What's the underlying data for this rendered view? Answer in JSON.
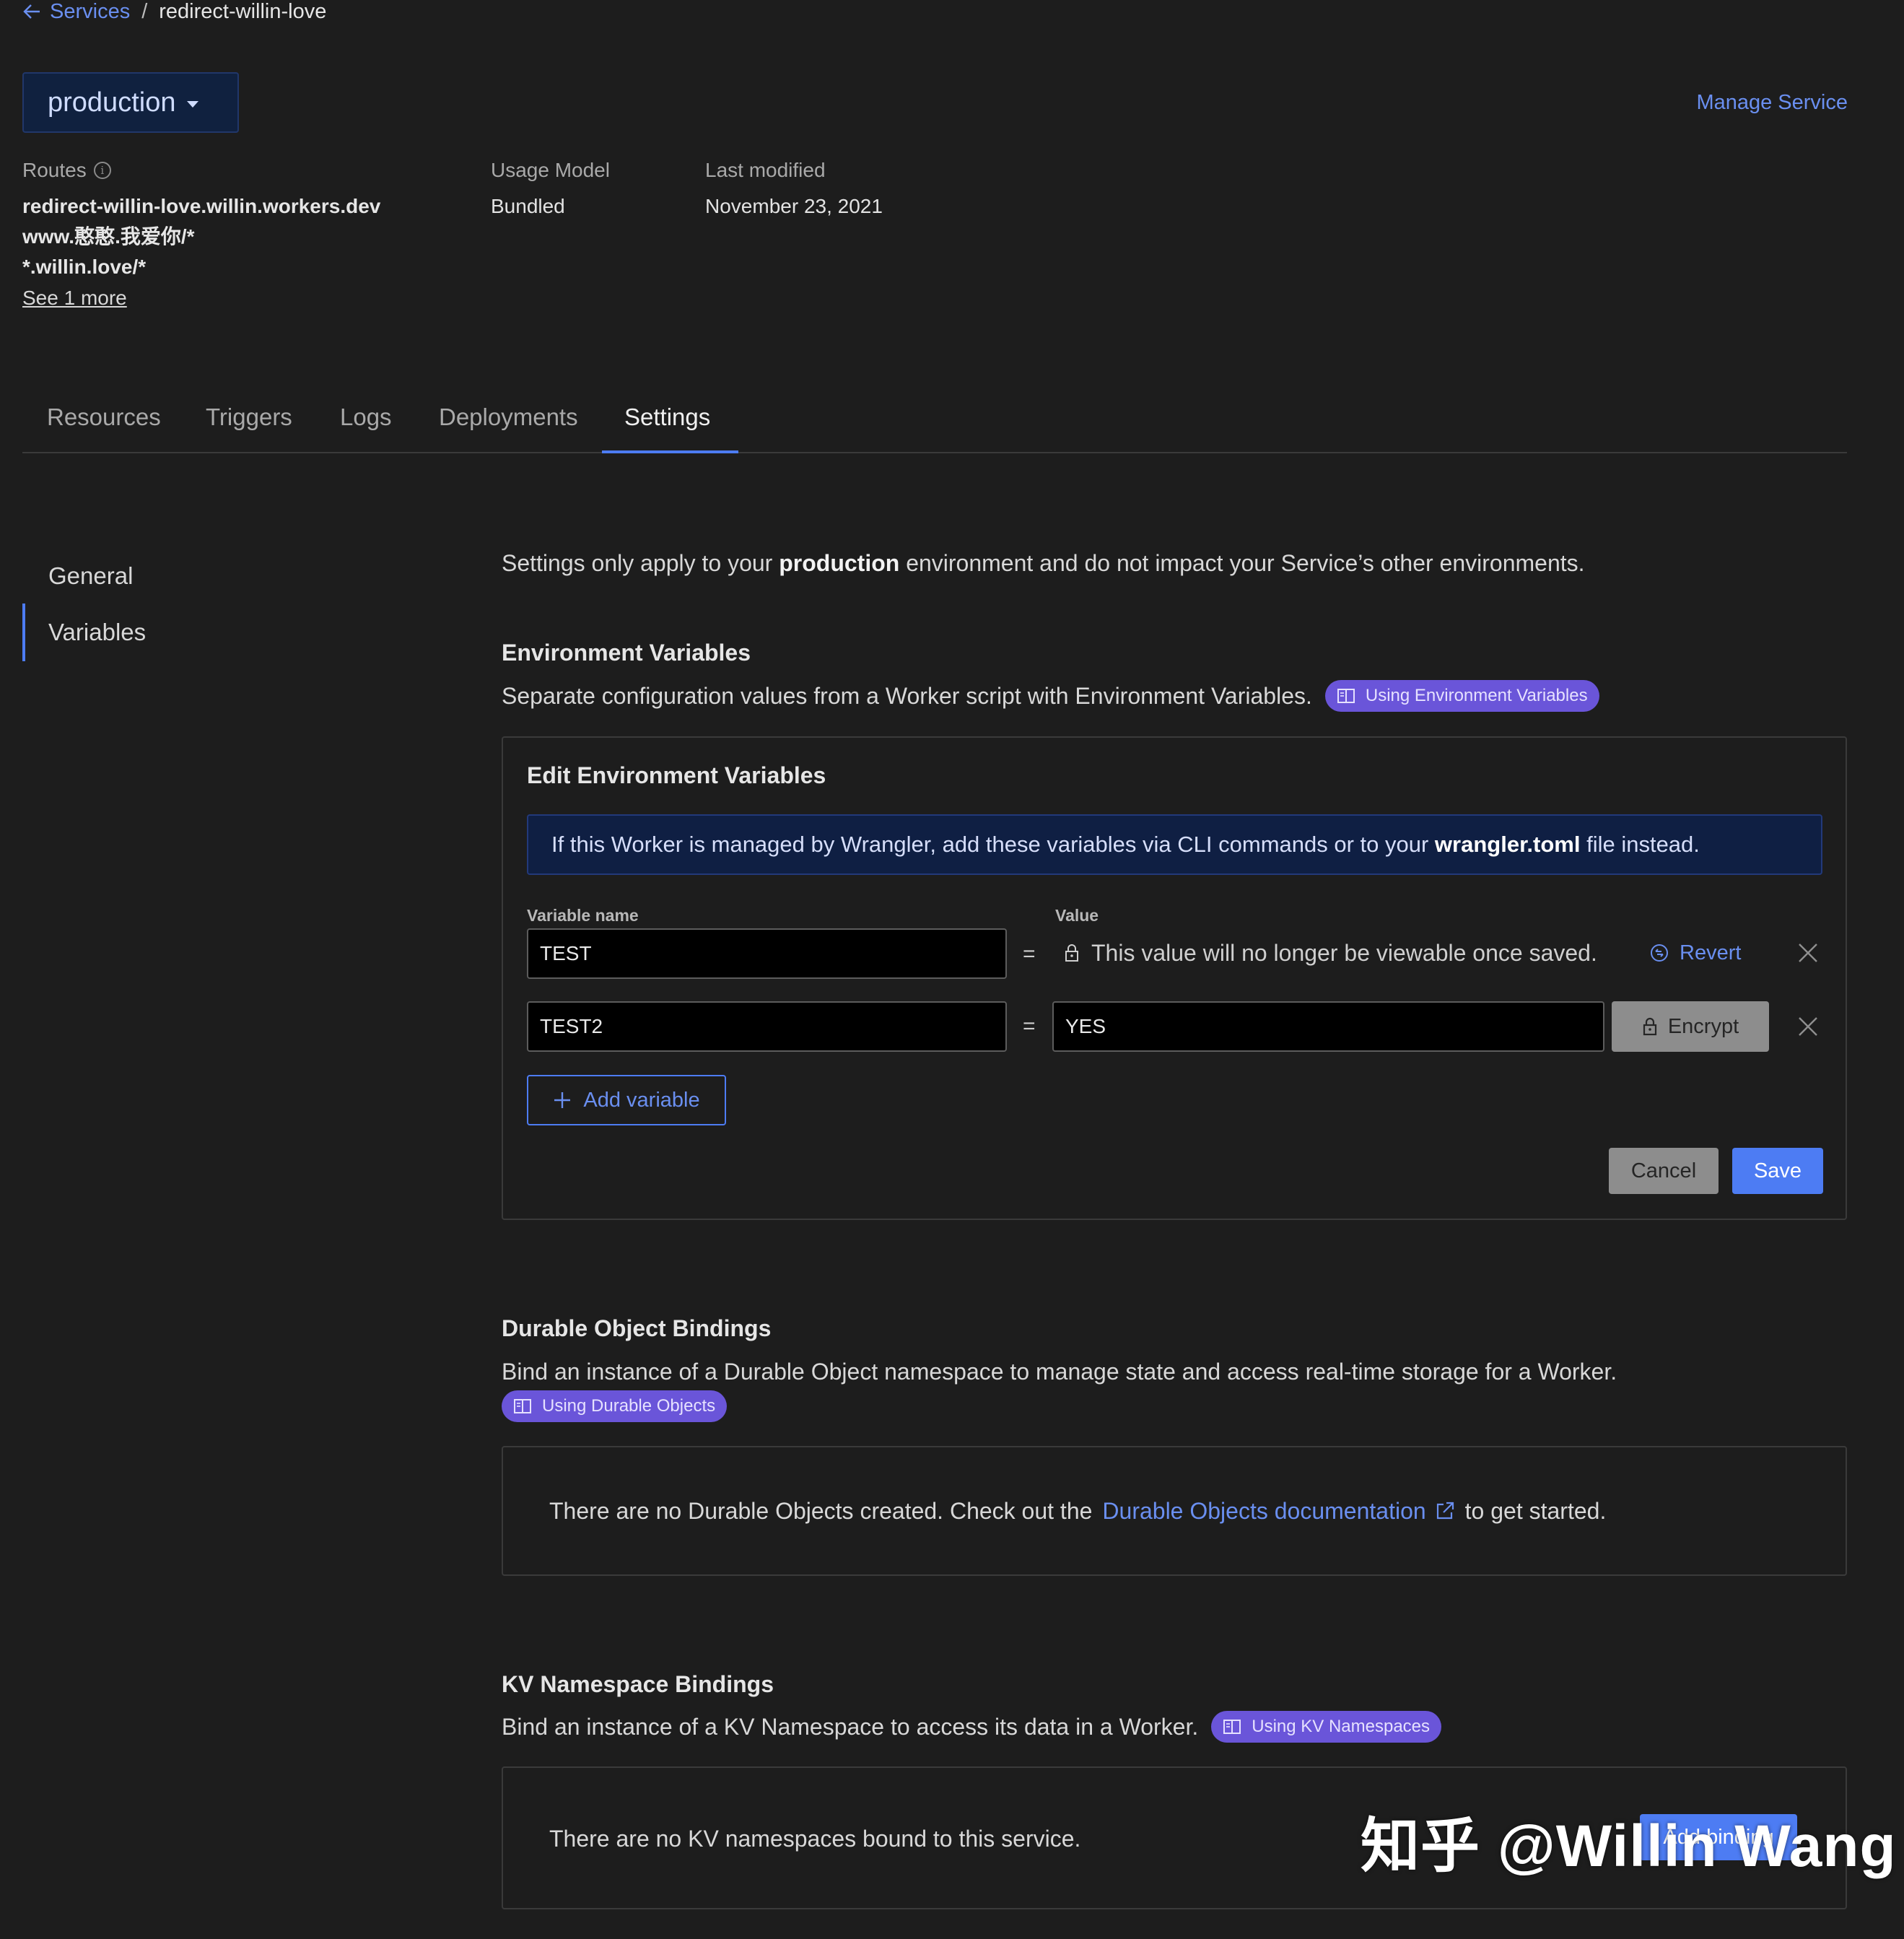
{
  "breadcrumb": {
    "back_label": "Services",
    "separator": "/",
    "current": "redirect-willin-love"
  },
  "environment": {
    "label": "production"
  },
  "header": {
    "manage_label": "Manage Service"
  },
  "meta": {
    "routes_label": "Routes",
    "routes": [
      "redirect-willin-love.willin.workers.dev",
      "www.憨憨.我爱你/*",
      "*.willin.love/*"
    ],
    "see_more": "See 1 more",
    "usage_model_label": "Usage Model",
    "usage_model_value": "Bundled",
    "last_modified_label": "Last modified",
    "last_modified_value": "November 23, 2021"
  },
  "tabs": [
    {
      "label": "Resources"
    },
    {
      "label": "Triggers"
    },
    {
      "label": "Logs"
    },
    {
      "label": "Deployments"
    },
    {
      "label": "Settings",
      "active": true
    }
  ],
  "side_nav": [
    {
      "label": "General"
    },
    {
      "label": "Variables",
      "active": true
    }
  ],
  "intro": {
    "prefix": "Settings only apply to your ",
    "env": "production",
    "suffix": " environment and do not impact your Service’s other environments."
  },
  "env_vars": {
    "title": "Environment Variables",
    "description": "Separate configuration values from a Worker script with Environment Variables.",
    "doc_pill": "Using Environment Variables",
    "panel_title": "Edit Environment Variables",
    "notice_prefix": "If this Worker is managed by Wrangler, add these variables via CLI commands or to your ",
    "notice_file": "wrangler.toml",
    "notice_suffix": " file instead.",
    "name_col": "Variable name",
    "value_col": "Value",
    "equals": "=",
    "rows": [
      {
        "name": "TEST",
        "locked_message": "This value will no longer be viewable once saved.",
        "revert_label": "Revert"
      },
      {
        "name": "TEST2",
        "value": "YES",
        "encrypt_label": "Encrypt"
      }
    ],
    "add_label": "Add variable",
    "cancel_label": "Cancel",
    "save_label": "Save"
  },
  "durable_objects": {
    "title": "Durable Object Bindings",
    "description": "Bind an instance of a Durable Object namespace to manage state and access real-time storage for a Worker.",
    "doc_pill": "Using Durable Objects",
    "empty_prefix": "There are no Durable Objects created. Check out the",
    "empty_link": "Durable Objects documentation",
    "empty_suffix": "to get started."
  },
  "kv": {
    "title": "KV Namespace Bindings",
    "description": "Bind an instance of a KV Namespace to access its data in a Worker.",
    "doc_pill": "Using KV Namespaces",
    "empty_text": "There are no KV namespaces bound to this service.",
    "add_label": "Add binding"
  },
  "watermark": "知乎 @Willin Wang",
  "colors": {
    "accent": "#4d7cf3",
    "link": "#6a8ff0",
    "pill": "#6a55d9",
    "background": "#1d1d1d"
  }
}
